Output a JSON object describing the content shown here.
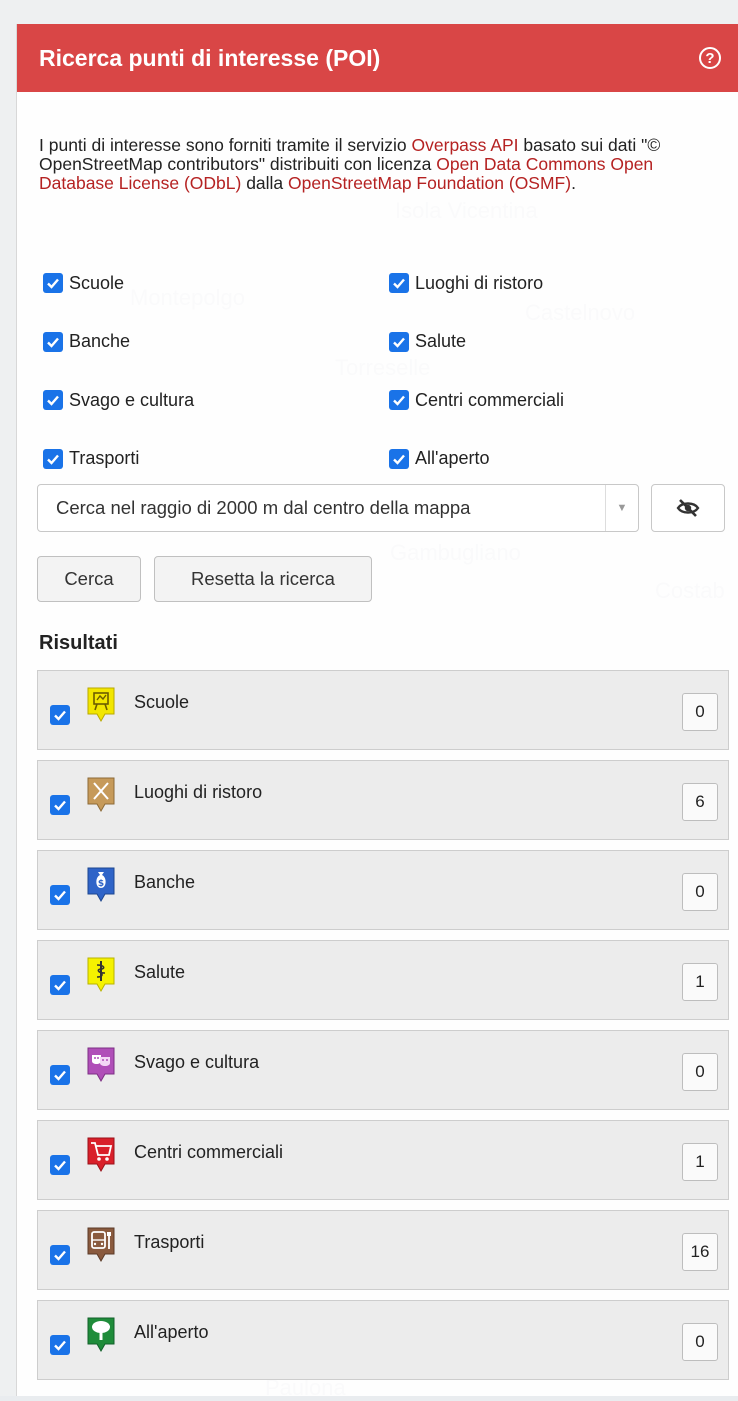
{
  "header": {
    "title": "Ricerca punti di interesse (POI)",
    "help_icon": "help-circle-icon"
  },
  "intro": {
    "t1": "I punti di interesse sono forniti tramite il servizio ",
    "link1": "Overpass API",
    "t2": " basato sui dati \"© OpenStreetMap contributors\" distribuiti con licenza ",
    "link2": "Open Data Commons Open Database License (ODbL)",
    "t3": " dalla ",
    "link3": "OpenStreetMap Foundation (OSMF)",
    "t4": "."
  },
  "categories": [
    {
      "label": "Scuole",
      "checked": true
    },
    {
      "label": "Luoghi di ristoro",
      "checked": true
    },
    {
      "label": "Banche",
      "checked": true
    },
    {
      "label": "Salute",
      "checked": true
    },
    {
      "label": "Svago e cultura",
      "checked": true
    },
    {
      "label": "Centri commerciali",
      "checked": true
    },
    {
      "label": "Trasporti",
      "checked": true
    },
    {
      "label": "All'aperto",
      "checked": true
    }
  ],
  "range_select": {
    "selected": "Cerca nel raggio di 2000 m dal centro della mappa"
  },
  "visibility_toggle_icon": "eye-off-icon",
  "buttons": {
    "search": "Cerca",
    "reset": "Resetta la ricerca"
  },
  "results": {
    "title": "Risultati",
    "items": [
      {
        "label": "Scuole",
        "count": "0",
        "icon": "school-icon",
        "color": "#f2e600"
      },
      {
        "label": "Luoghi di ristoro",
        "count": "6",
        "icon": "restaurant-icon",
        "color": "#c69a5a"
      },
      {
        "label": "Banche",
        "count": "0",
        "icon": "bank-icon",
        "color": "#2f64c8"
      },
      {
        "label": "Salute",
        "count": "1",
        "icon": "health-icon",
        "color": "#f5f200"
      },
      {
        "label": "Svago e cultura",
        "count": "0",
        "icon": "culture-icon",
        "color": "#b04fb8"
      },
      {
        "label": "Centri commerciali",
        "count": "1",
        "icon": "shopping-cart-icon",
        "color": "#d9202a"
      },
      {
        "label": "Trasporti",
        "count": "16",
        "icon": "transport-icon",
        "color": "#8a5a3e"
      },
      {
        "label": "All'aperto",
        "count": "0",
        "icon": "tree-icon",
        "color": "#1f8c3a"
      }
    ]
  },
  "colors": {
    "header_bg": "#d94646",
    "link": "#b52222",
    "checkbox": "#1a73e8"
  }
}
